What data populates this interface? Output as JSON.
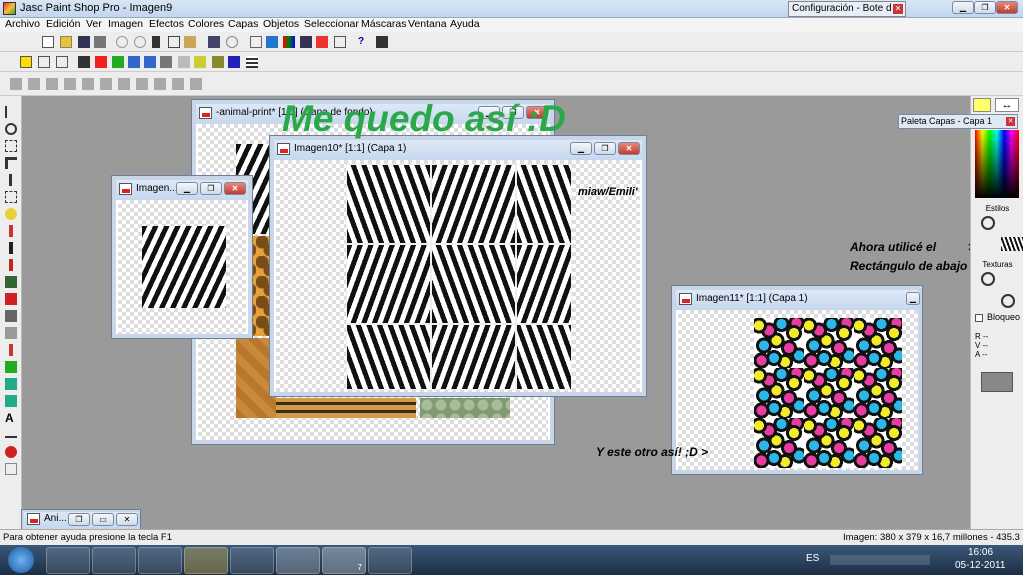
{
  "app": {
    "title": "Jasc Paint Shop Pro - Imagen9",
    "colors": {
      "accent": "#2aa84a",
      "titlebar": "#c6d7ee"
    }
  },
  "config_window": {
    "title": "Configuración - Bote d"
  },
  "menu": [
    "Archivo",
    "Edición",
    "Ver",
    "Imagen",
    "Efectos",
    "Colores",
    "Capas",
    "Objetos",
    "Seleccionar",
    "Máscaras",
    "Ventana",
    "Ayuda"
  ],
  "windows": {
    "animal_print": {
      "title": "-animal-print* [1:1] (Capa de fondo)"
    },
    "imagen_small": {
      "title": "Imagen..."
    },
    "imagen10": {
      "title": "Imagen10* [1:1] (Capa 1)"
    },
    "imagen11": {
      "title": "Imagen11* [1:1] (Capa 1)"
    },
    "minimized": {
      "title": "Ani..."
    }
  },
  "overlay": {
    "headline": "Me quedo así :D",
    "signature": "miaw/Emili'",
    "note1_line1": "Ahora utilicé el",
    "note1_line2": "Rectángulo de abajo",
    "note2": "Y este otro así! ;D >",
    "arrow": ">"
  },
  "layers_palette": {
    "title": "Paleta Capas - Capa 1"
  },
  "styles_panel": {
    "estilos": "Estilos",
    "texturas": "Texturas",
    "bloqueo": "Bloqueo",
    "r": "R",
    "v": "V",
    "a": "A",
    "r_val": "--",
    "v_val": "--",
    "a_val": "--"
  },
  "status": {
    "help": "Para obtener ayuda presione la tecla F1",
    "image_info": "Imagen:  380 x 379 x 16,7 millones - 435.3 KB"
  },
  "taskbar": {
    "lang": "ES",
    "time": "16:06",
    "date": "05-12-2011",
    "badge": "7"
  }
}
